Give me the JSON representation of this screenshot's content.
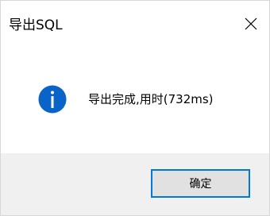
{
  "window": {
    "title": "导出SQL",
    "close_icon": "close-icon"
  },
  "message": {
    "icon": "info-icon",
    "icon_color": "#0a64c8",
    "text": "导出完成,用时(732ms)"
  },
  "footer": {
    "ok_label": "确定",
    "accent": "#0078d7",
    "background": "#f0f0f0"
  }
}
